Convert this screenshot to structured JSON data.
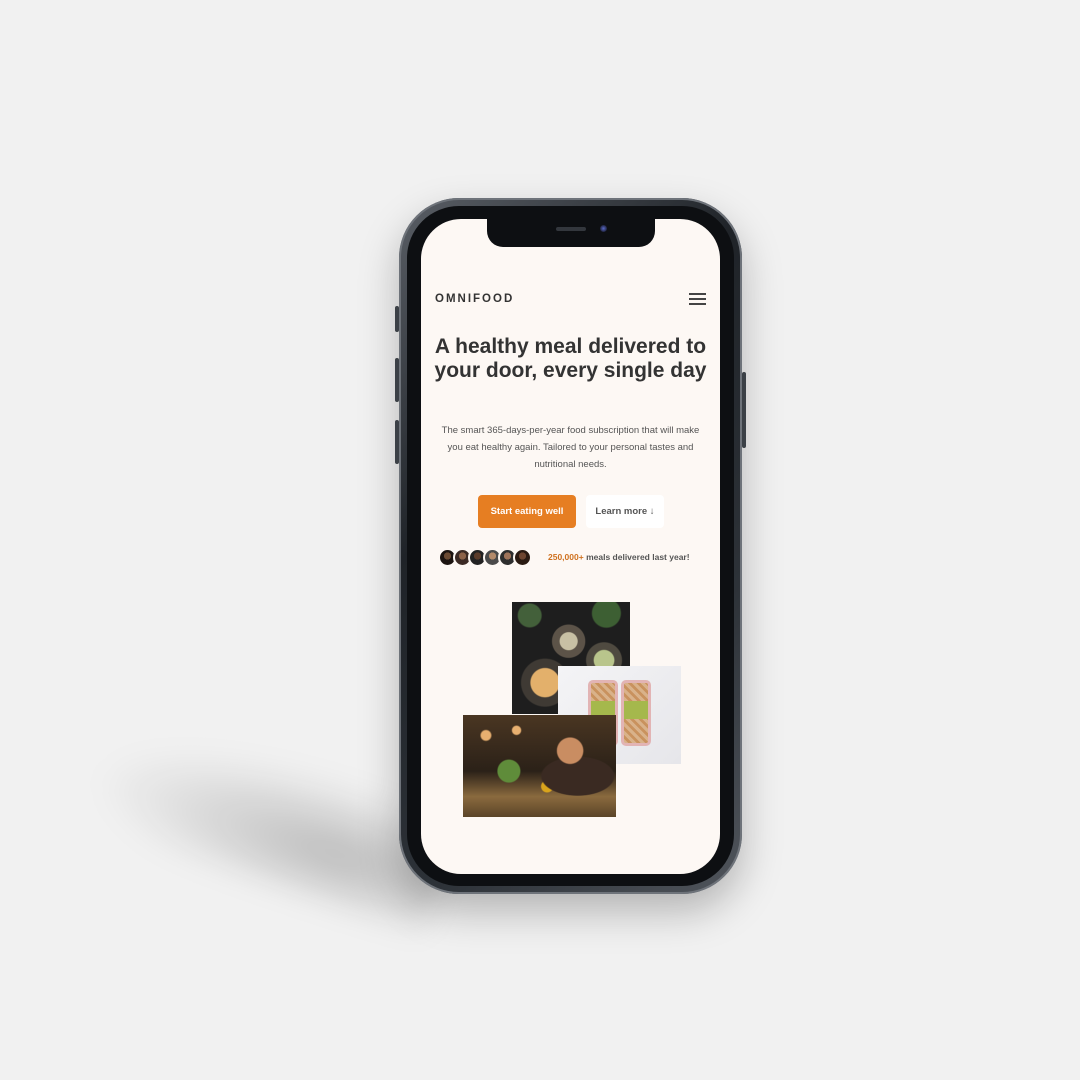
{
  "app": {
    "logo": "OMNIFOOD",
    "menu_icon": "hamburger-menu-icon"
  },
  "hero": {
    "title": "A healthy meal delivered to your door, every single day",
    "description": "The smart 365-days-per-year food subscription that will make you eat healthy again. Tailored to your personal tastes and nutritional needs.",
    "primary_button": "Start eating well",
    "secondary_button": "Learn more ↓"
  },
  "social_proof": {
    "count": "250,000+",
    "text": "meals delivered last year!",
    "avatar_count": 6
  },
  "colors": {
    "accent": "#e67e22",
    "page_background": "#fdf8f4",
    "text": "#333333"
  },
  "gallery": {
    "images": [
      "food-bowls-photo",
      "meal-prep-boxes-photo",
      "woman-dining-photo"
    ]
  }
}
